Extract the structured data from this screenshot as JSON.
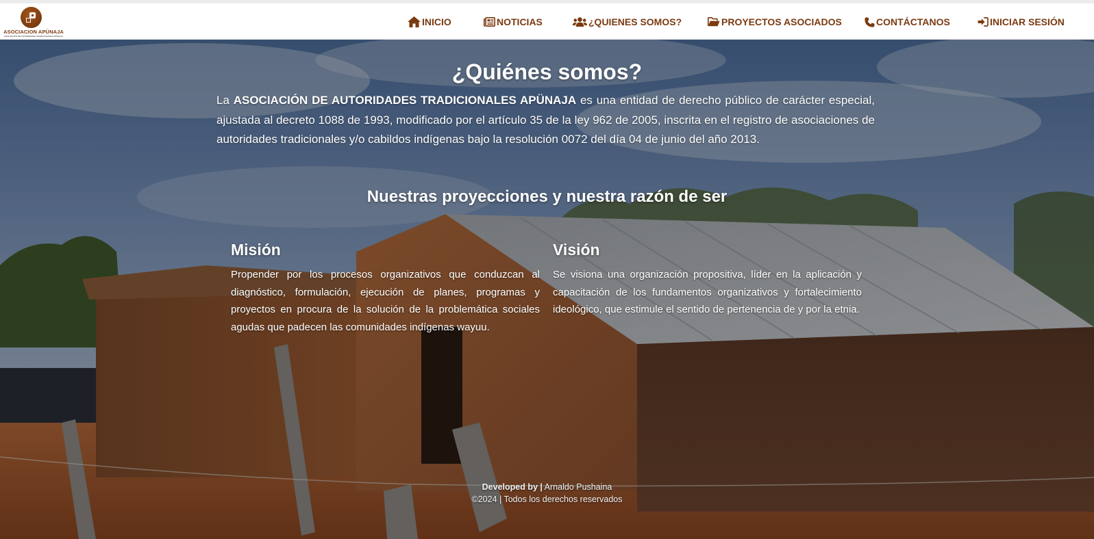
{
  "logo": {
    "title": "ASOCIACION APÜNAJA",
    "subtitle": "ASOCIACION DE AUTORIDADES TRADICIONALES APÜNAJA"
  },
  "nav": {
    "items": [
      {
        "label": "INICIO",
        "icon": "home-icon"
      },
      {
        "label": "NOTICIAS",
        "icon": "newspaper-icon"
      },
      {
        "label": "¿QUIENES SOMOS?",
        "icon": "users-icon"
      },
      {
        "label": "PROYECTOS ASOCIADOS",
        "icon": "folder-open-icon"
      },
      {
        "label": "CONTÁCTANOS",
        "icon": "phone-icon"
      },
      {
        "label": "INICIAR SESIÓN",
        "icon": "sign-in-icon"
      }
    ]
  },
  "about": {
    "title": "¿Quiénes somos?",
    "intro_prefix": "La ",
    "intro_org": "ASOCIACIÓN DE AUTORIDADES TRADICIONALES APÜNAJA",
    "intro_text": " es una entidad de derecho público de carácter especial, ajustada al decreto 1088 de 1993, modificado por el artículo 35 de la ley 962 de 2005, inscrita en el registro de asociaciones de autoridades tradicionales y/o cabildos indígenas bajo la resolución 0072 del día 04 de junio del año 2013."
  },
  "projections": {
    "title": "Nuestras proyecciones y nuestra razón de ser",
    "mision": {
      "heading": "Misión",
      "text": "Propender por los procesos organizativos que conduzcan al diagnóstico, formulación, ejecución de planes, programas y proyectos en procura de la solución de la problemática sociales agudas que padecen las comunidades indígenas wayuu."
    },
    "vision": {
      "heading": "Visión",
      "text": "Se visiona una organización propositiva, líder en la aplicación y capacitación de los fundamentos organizativos y fortalecimiento ideológico, que estimule el sentido de pertenencia de y por la etnia."
    }
  },
  "footer": {
    "developed_label": "Developed by |",
    "developer": " Arnaldo Pushaina",
    "copyright": "©2024 | Todos los derechos reservados"
  },
  "colors": {
    "brand": "#7b3a10",
    "header_bg": "#ffffff",
    "text_light": "#ffffff"
  }
}
